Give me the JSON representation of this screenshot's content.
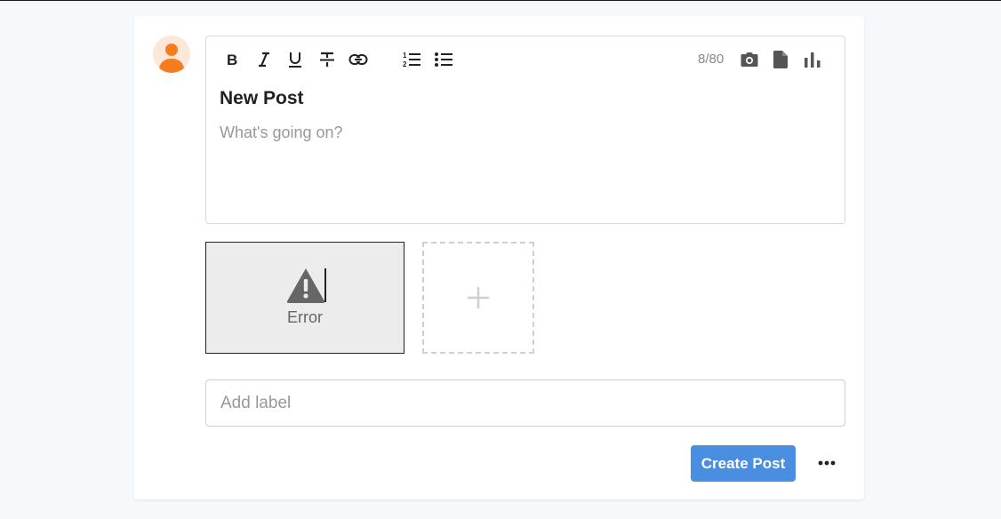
{
  "composer": {
    "toolbar": {
      "formatting": [
        {
          "name": "bold-icon",
          "label": "Bold"
        },
        {
          "name": "italic-icon",
          "label": "Italic"
        },
        {
          "name": "underline-icon",
          "label": "Underline"
        },
        {
          "name": "strikethrough-icon",
          "label": "Strikethrough"
        },
        {
          "name": "link-icon",
          "label": "Link"
        }
      ],
      "lists": [
        {
          "name": "ordered-list-icon",
          "label": "Numbered list"
        },
        {
          "name": "bullet-list-icon",
          "label": "Bulleted list"
        }
      ],
      "char_count": "8/80",
      "attachments": [
        {
          "name": "camera-icon",
          "label": "Add photo"
        },
        {
          "name": "file-icon",
          "label": "Add file"
        },
        {
          "name": "bar-chart-icon",
          "label": "Add poll"
        }
      ]
    },
    "title": "New Post",
    "body_placeholder": "What's going on?"
  },
  "media": {
    "error_text": "Error",
    "add_icon": "plus-icon"
  },
  "label_field": {
    "placeholder": "Add label",
    "value": ""
  },
  "actions": {
    "submit_label": "Create Post",
    "more_icon": "more-horizontal-icon"
  },
  "colors": {
    "accent": "#4a8ee2",
    "avatar": "#f57c1f",
    "avatar_bg": "#fde7d9",
    "page_bg": "#f6f9fc"
  }
}
